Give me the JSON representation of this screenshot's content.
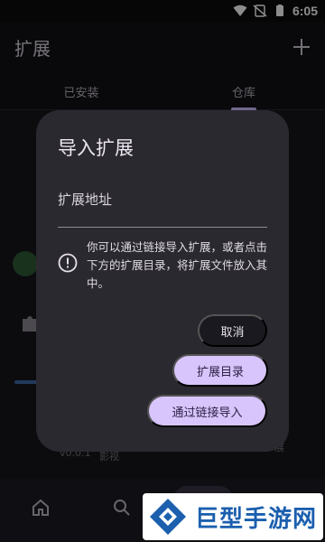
{
  "status_bar": {
    "time": "6:05"
  },
  "app_bar": {
    "title": "扩展",
    "add_icon": "add-icon"
  },
  "tabs": [
    {
      "label": "已安装",
      "active": false
    },
    {
      "label": "仓库",
      "active": true
    }
  ],
  "background_list": {
    "version": "v0.0.1",
    "tag": "影视",
    "tag2": "展"
  },
  "dialog": {
    "title": "导入扩展",
    "url_placeholder": "扩展地址",
    "info_icon": "info-circle-icon",
    "info_text": "你可以通过链接导入扩展，或者点击下方的扩展目录，将扩展文件放入其中。",
    "buttons": {
      "cancel": "取消",
      "catalog": "扩展目录",
      "import_link": "通过链接导入"
    }
  },
  "bottom_nav": {
    "items": [
      "home-icon",
      "search-icon",
      "extensions-icon"
    ]
  },
  "watermark": {
    "text": "巨型手游网"
  },
  "colors": {
    "accent": "#d7c5fb",
    "dialog_bg": "#2b2930",
    "background": "#16151b"
  }
}
